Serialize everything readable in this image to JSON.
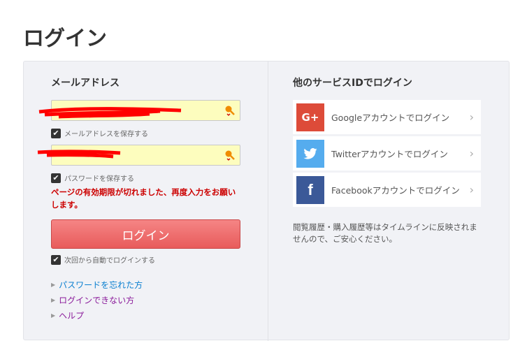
{
  "page_title": "ログイン",
  "left": {
    "email_label": "メールアドレス",
    "email_value": "",
    "save_email_label": "メールアドレスを保存する",
    "save_password_label": "パスワードを保存する",
    "password_value": "",
    "error_message": "ページの有効期限が切れました、再度入力をお願いします。",
    "login_button": "ログイン",
    "auto_login_label": "次回から自動でログインする",
    "links": [
      "パスワードを忘れた方",
      "ログインできない方",
      "ヘルプ"
    ]
  },
  "right": {
    "title": "他のサービスIDでログイン",
    "services": [
      {
        "label": "Googleアカウントでログイン",
        "icon": "G+",
        "color": "#dd4b39"
      },
      {
        "label": "Twitterアカウントでログイン",
        "icon": "twitter",
        "color": "#55acee"
      },
      {
        "label": "Facebookアカウントでログイン",
        "icon": "f",
        "color": "#3b5998"
      }
    ],
    "note": "閲覧履歴・購入履歴等はタイムラインに反映されませんので、ご安心ください。"
  }
}
